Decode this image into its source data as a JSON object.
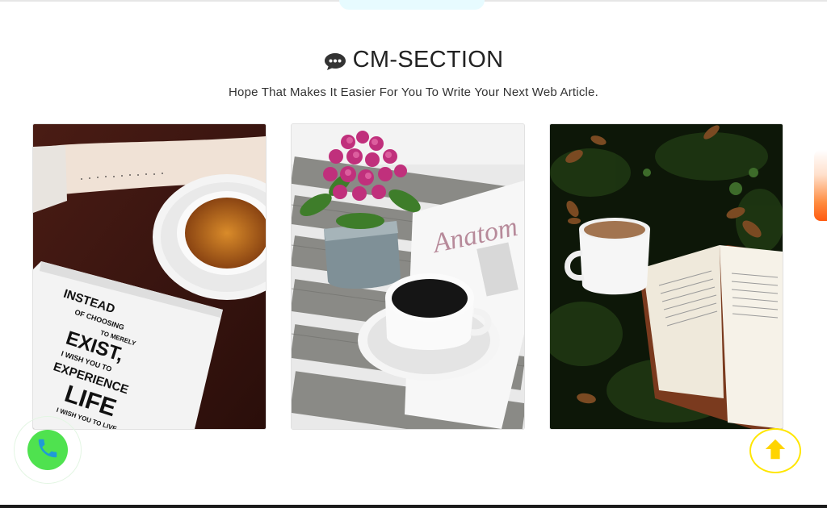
{
  "section": {
    "icon": "chat-bubble-icon",
    "title": "CM-SECTION",
    "subtitle": "Hope That Makes It Easier For You To Write Your Next Web Article."
  },
  "cards": [
    {
      "image": "coffee-cup-and-notebook-photo",
      "notebook_text": [
        "INSTEAD",
        "OF CHOOSING",
        "TO MERELY",
        "EXIST,",
        "I WISH YOU TO",
        "EXPERIENCE",
        "LIFE",
        "I WISH YOU TO LIVE"
      ]
    },
    {
      "image": "flowers-and-coffee-on-crate-photo",
      "magazine_text": "Anatom"
    },
    {
      "image": "coffee-and-book-on-grass-photo"
    }
  ],
  "floating": {
    "phone_icon": "phone-icon",
    "up_icon": "arrow-up-icon"
  },
  "colors": {
    "phone": "#4fe24f",
    "scroll_top_ring": "#ffe600",
    "scroll_top_arrow": "#ffd400",
    "scroll_indicator": "#ff5a10"
  }
}
